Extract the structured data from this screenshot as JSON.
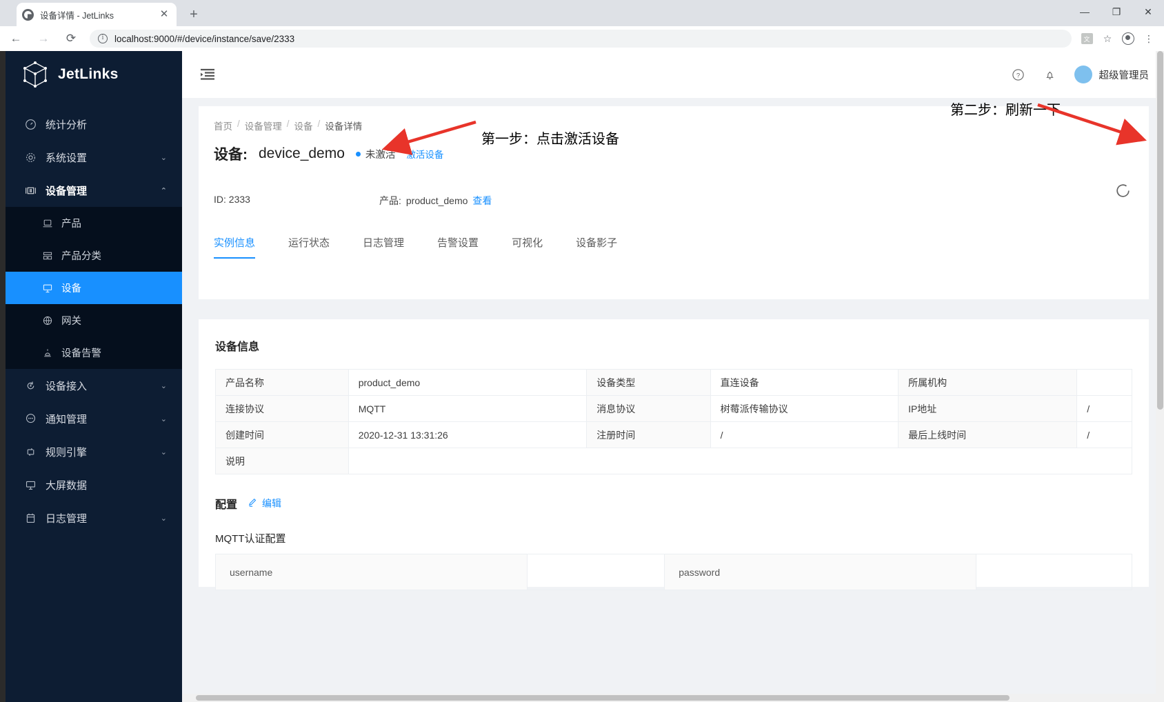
{
  "browser": {
    "tab_title": "设备详情 - JetLinks",
    "new_tab_label": "+",
    "close_label": "✕",
    "back_label": "←",
    "forward_label": "→",
    "reload_label": "⟳",
    "url": "localhost:9000/#/device/instance/save/2333",
    "translate_label": "文",
    "star_label": "☆",
    "menu_label": "⋮",
    "win_min": "—",
    "win_max": "❐",
    "win_close": "✕"
  },
  "sidebar": {
    "brand": "JetLinks",
    "items": [
      {
        "label": "统计分析",
        "icon": "dashboard-icon",
        "caret": ""
      },
      {
        "label": "系统设置",
        "icon": "gear-icon",
        "caret": "⌄"
      },
      {
        "label": "设备管理",
        "icon": "device-manage-icon",
        "caret": "⌃"
      }
    ],
    "submenu": [
      {
        "label": "产品",
        "icon": "product-icon"
      },
      {
        "label": "产品分类",
        "icon": "category-icon"
      },
      {
        "label": "设备",
        "icon": "monitor-icon"
      },
      {
        "label": "网关",
        "icon": "globe-icon"
      },
      {
        "label": "设备告警",
        "icon": "alarm-icon"
      }
    ],
    "items_after": [
      {
        "label": "设备接入",
        "icon": "access-icon",
        "caret": "⌄"
      },
      {
        "label": "通知管理",
        "icon": "message-icon",
        "caret": "⌄"
      },
      {
        "label": "规则引擎",
        "icon": "rule-icon",
        "caret": "⌄"
      },
      {
        "label": "大屏数据",
        "icon": "screen-icon",
        "caret": ""
      },
      {
        "label": "日志管理",
        "icon": "log-icon",
        "caret": "⌄"
      }
    ],
    "selected": "设备"
  },
  "topbar": {
    "collapse_icon": "menu-fold-icon",
    "help_icon": "question-circle-icon",
    "bell_icon": "bell-icon",
    "user_name": "超级管理员"
  },
  "page": {
    "breadcrumb": [
      "首页",
      "设备管理",
      "设备",
      "设备详情"
    ],
    "breadcrumb_sep": "/",
    "device_label": "设备:",
    "device_name": "device_demo",
    "status_text": "未激活",
    "activate_link": "激活设备",
    "id_text": "ID: 2333",
    "product_label": "产品:",
    "product_name": "product_demo",
    "product_view": "查看",
    "refresh_icon": "refresh-icon",
    "tabs": [
      {
        "label": "实例信息",
        "active": true
      },
      {
        "label": "运行状态",
        "active": false
      },
      {
        "label": "日志管理",
        "active": false
      },
      {
        "label": "告警设置",
        "active": false
      },
      {
        "label": "可视化",
        "active": false
      },
      {
        "label": "设备影子",
        "active": false
      }
    ]
  },
  "device_info": {
    "section_title": "设备信息",
    "rows": [
      {
        "k1": "产品名称",
        "v1": "product_demo",
        "k2": "设备类型",
        "v2": "直连设备",
        "k3": "所属机构",
        "v3": ""
      },
      {
        "k1": "连接协议",
        "v1": "MQTT",
        "k2": "消息协议",
        "v2": "树莓派传输协议",
        "k3": "IP地址",
        "v3": "/"
      },
      {
        "k1": "创建时间",
        "v1": "2020-12-31 13:31:26",
        "k2": "注册时间",
        "v2": "/",
        "k3": "最后上线时间",
        "v3": "/"
      }
    ],
    "desc_label": "说明",
    "desc_value": ""
  },
  "config": {
    "title": "配置",
    "edit_label": "编辑",
    "edit_icon": "pencil-icon",
    "sub_title": "MQTT认证配置",
    "rows": [
      {
        "k1": "username",
        "v1": "",
        "k2": "password",
        "v2": ""
      }
    ]
  },
  "annotations": {
    "step1": "第一步：点击激活设备",
    "step2": "第二步：刷新一下",
    "arrow_color": "#e8342a"
  },
  "colors": {
    "accent": "#1890ff",
    "sidebar_bg": "#0d1d33",
    "submenu_bg": "#050f1d",
    "page_bg": "#f0f2f5"
  }
}
